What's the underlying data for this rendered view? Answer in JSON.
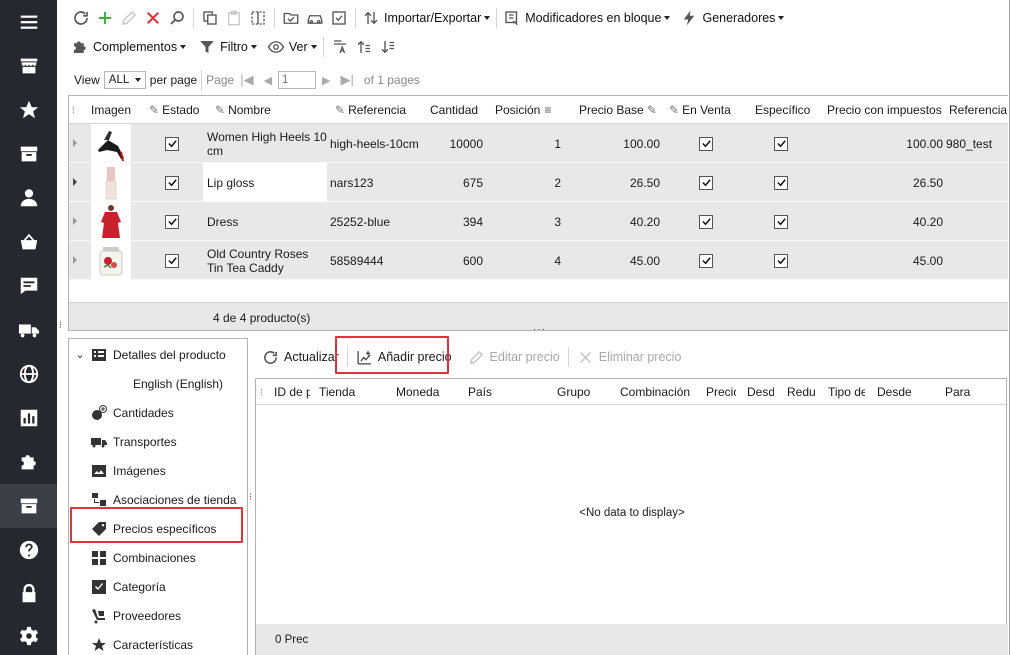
{
  "sidebar": {
    "icons": [
      "menu-icon",
      "store-icon",
      "star-icon",
      "box-icon",
      "user-icon",
      "basket-icon",
      "message-icon",
      "truck-icon",
      "globe-icon",
      "chart-icon",
      "puzzle-icon",
      "box-active-icon",
      "help-icon",
      "lock-icon",
      "gear-icon"
    ]
  },
  "toolbar1": {
    "import_export": "Importar/Exportar",
    "bulk_modifiers": "Modificadores en bloque",
    "generators": "Generadores"
  },
  "toolbar2": {
    "addons": "Complementos",
    "filter": "Filtro",
    "view": "Ver"
  },
  "pager": {
    "view_label": "View",
    "view_value": "ALL",
    "per_page": "per page",
    "page_label": "Page",
    "page_value": "1",
    "of_pages": "of 1 pages"
  },
  "grid": {
    "columns": [
      "Imagen",
      "Estado",
      "Nombre",
      "Referencia",
      "Cantidad",
      "Posición",
      "Precio Base",
      "En Venta",
      "Específico",
      "Precio con impuestos",
      "Referencia"
    ],
    "rows": [
      {
        "name": "Women High Heels 10 cm",
        "ref": "high-heels-10cm",
        "qty": "10000",
        "pos": "1",
        "base": "100.00",
        "tax": "100.00",
        "ref2": "980_test"
      },
      {
        "name": "Lip gloss",
        "ref": "nars123",
        "qty": "675",
        "pos": "2",
        "base": "26.50",
        "tax": "26.50",
        "ref2": ""
      },
      {
        "name": "Dress",
        "ref": "25252-blue",
        "qty": "394",
        "pos": "3",
        "base": "40.20",
        "tax": "40.20",
        "ref2": ""
      },
      {
        "name": "Old Country Roses Tin Tea Caddy",
        "ref": "58589444",
        "qty": "600",
        "pos": "4",
        "base": "45.00",
        "tax": "45.00",
        "ref2": ""
      }
    ],
    "footer": "4 de 4 producto(s)"
  },
  "tree": {
    "items": [
      "Detalles del producto",
      "English (English)",
      "Cantidades",
      "Transportes",
      "Imágenes",
      "Asociaciones de tienda",
      "Precios específicos",
      "Combinaciones",
      "Categoría",
      "Proveedores",
      "Características"
    ]
  },
  "panel": {
    "refresh": "Actualizar",
    "add": "Añadir precio",
    "edit": "Editar precio",
    "delete": "Eliminar precio",
    "columns": [
      "ID de p",
      "Tienda",
      "Moneda",
      "País",
      "Grupo",
      "Combinación",
      "Precio",
      "Desde",
      "Reduc",
      "Tipo de",
      "Desde",
      "Para"
    ],
    "nodata": "<No data to display>",
    "footer": "0 Prec"
  },
  "colors": {
    "sidebar": "#25282e",
    "highlight": "#e0343c",
    "row_bg": "#e8e8e8"
  }
}
